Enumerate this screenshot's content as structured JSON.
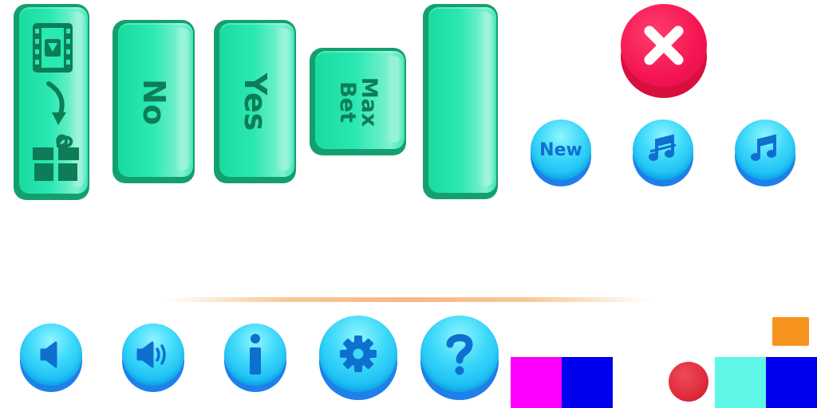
{
  "buttons": {
    "video_gift": {
      "icons": [
        "film-icon",
        "arrow-down-icon",
        "gift-icon"
      ]
    },
    "no": {
      "label": "No"
    },
    "yes": {
      "label": "Yes"
    },
    "max_bet": {
      "line1": "Max",
      "line2": "Bet"
    },
    "blank": {
      "label": ""
    },
    "close": {
      "icon": "close-x-icon"
    },
    "new": {
      "label": "New"
    },
    "music_off": {
      "icon": "music-note-strike-icon"
    },
    "music_on": {
      "icon": "music-note-icon"
    },
    "sound_off": {
      "icon": "speaker-icon"
    },
    "sound_on": {
      "icon": "speaker-wave-icon"
    },
    "info": {
      "icon": "info-icon"
    },
    "settings": {
      "icon": "gear-icon"
    },
    "help": {
      "icon": "question-icon"
    }
  },
  "colors": {
    "green_face": "#2ae8b2",
    "green_edge": "#14a06e",
    "green_text": "#0d7d57",
    "red": "#f41552",
    "blue_face": "#3ed9fa",
    "blue_edge": "#1e80e8",
    "blue_glyph": "#0f6fcf",
    "magenta": "#ff00ff",
    "deep_blue": "#0000ee",
    "orange": "#f7941d",
    "cyan": "#5ef6e6",
    "dot_red": "#e02b3c"
  }
}
